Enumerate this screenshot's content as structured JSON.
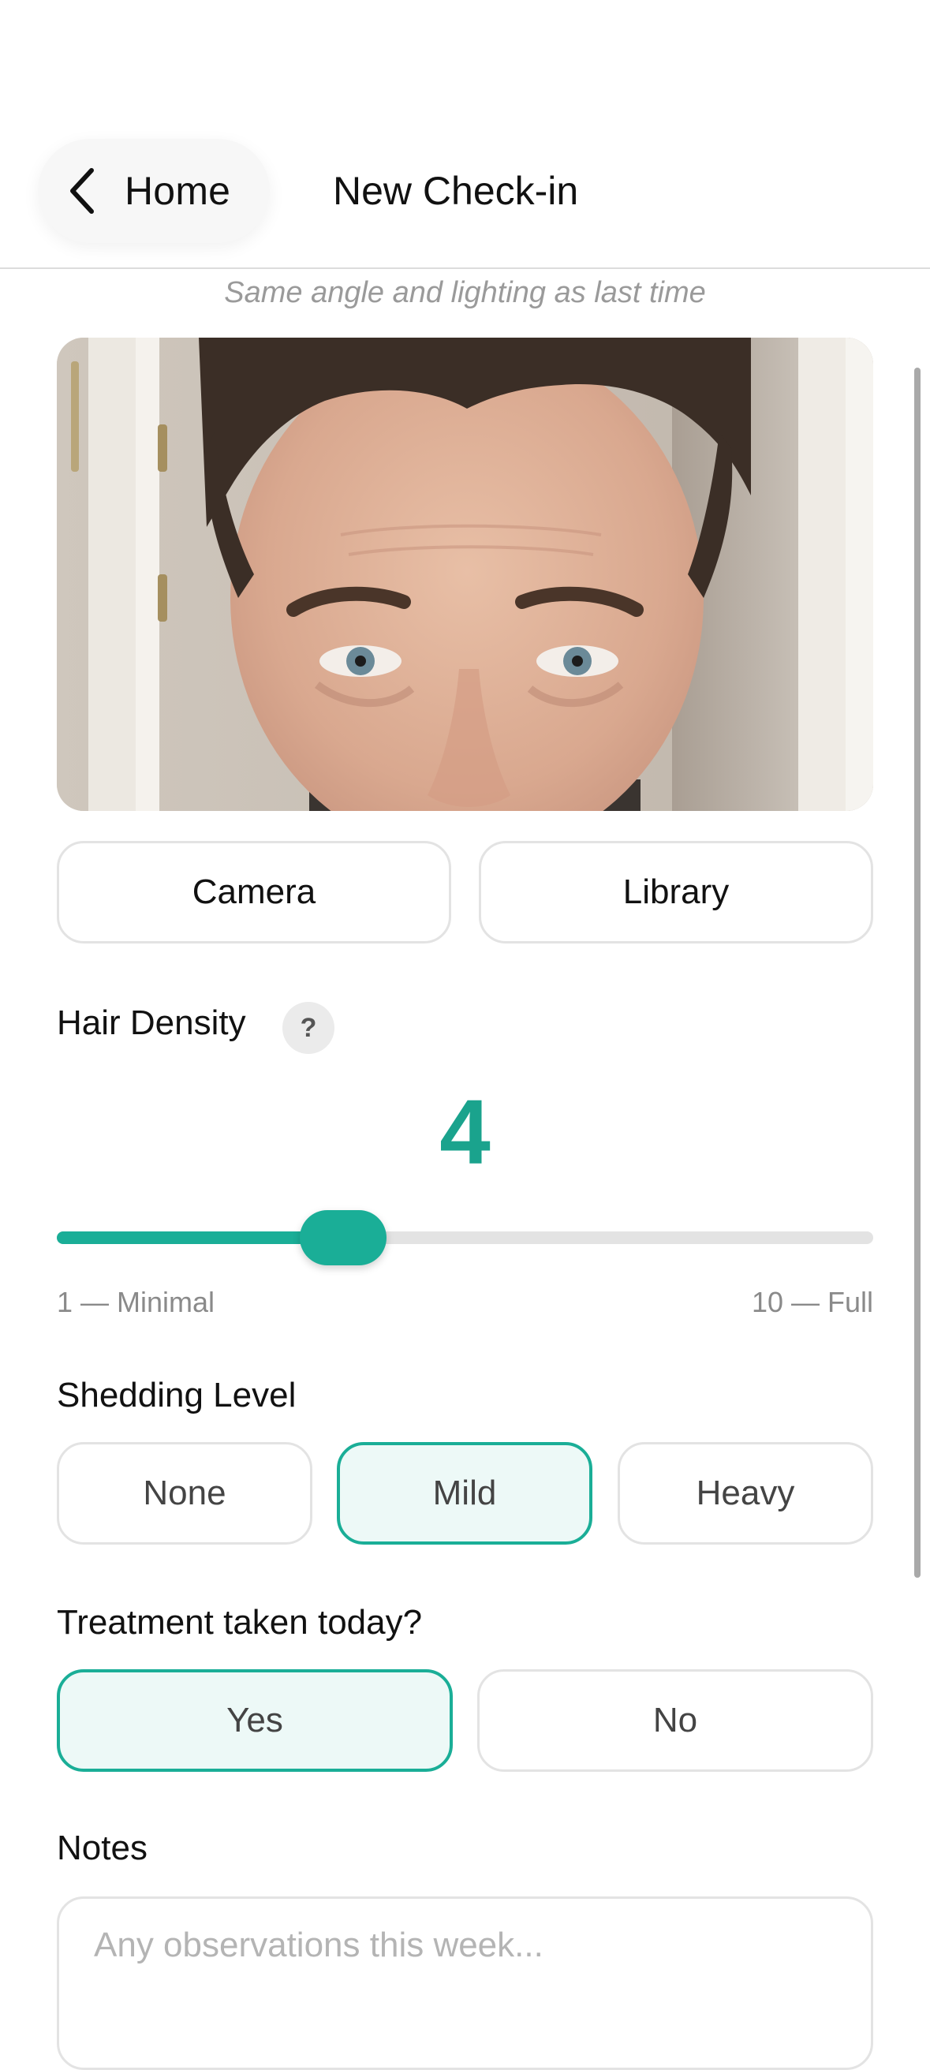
{
  "header": {
    "back_label": "Home",
    "title": "New Check-in",
    "hint": "Same angle and lighting as last time"
  },
  "photo": {
    "subject": "hairline-photo"
  },
  "photo_actions": {
    "camera_label": "Camera",
    "library_label": "Library"
  },
  "density": {
    "label": "Hair Density",
    "help_icon": "?",
    "value": "4",
    "value_num": 4,
    "min": 1,
    "max": 10,
    "min_label": "1 — Minimal",
    "max_label": "10 — Full"
  },
  "shedding": {
    "label": "Shedding Level",
    "options": [
      "None",
      "Mild",
      "Heavy"
    ],
    "selected": "Mild"
  },
  "treatment": {
    "label": "Treatment taken today?",
    "options": [
      "Yes",
      "No"
    ],
    "selected": "Yes"
  },
  "notes": {
    "label": "Notes",
    "placeholder": "Any observations this week..."
  },
  "colors": {
    "accent": "#1aae97",
    "accent_bg": "#edf9f7"
  }
}
